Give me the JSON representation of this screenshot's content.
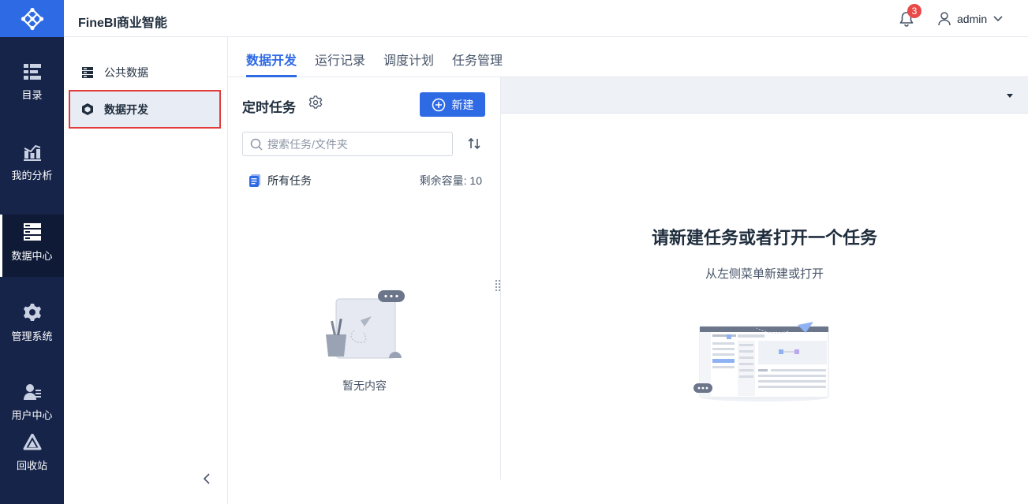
{
  "header": {
    "app_title": "FineBI商业智能",
    "notification_count": "3",
    "user_name": "admin"
  },
  "rail": {
    "items": [
      {
        "label": "目录",
        "icon": "catalog-icon"
      },
      {
        "label": "我的分析",
        "icon": "analysis-chart-icon"
      },
      {
        "label": "数据中心",
        "icon": "data-center-icon",
        "active": true
      },
      {
        "label": "管理系统",
        "icon": "gear-system-icon"
      },
      {
        "label": "用户中心",
        "icon": "user-center-icon"
      },
      {
        "label": "回收站",
        "icon": "recycle-bin-icon"
      }
    ]
  },
  "subnav": {
    "items": [
      {
        "label": "公共数据",
        "icon": "server-data-icon"
      },
      {
        "label": "数据开发",
        "icon": "cube-icon",
        "selected": true
      }
    ]
  },
  "tabs": [
    {
      "label": "数据开发",
      "active": true
    },
    {
      "label": "运行记录"
    },
    {
      "label": "调度计划"
    },
    {
      "label": "任务管理"
    }
  ],
  "task_panel": {
    "title": "定时任务",
    "new_button": "新建",
    "search_placeholder": "搜索任务/文件夹",
    "all_tasks_label": "所有任务",
    "capacity_label": "剩余容量: 10",
    "empty_text": "暂无内容"
  },
  "workspace": {
    "title": "请新建任务或者打开一个任务",
    "subtitle": "从左侧菜单新建或打开"
  },
  "colors": {
    "rail_bg": "#16244a",
    "accent": "#2f6ae5",
    "badge": "#e84a4a",
    "highlight_border": "#e23b3b"
  }
}
